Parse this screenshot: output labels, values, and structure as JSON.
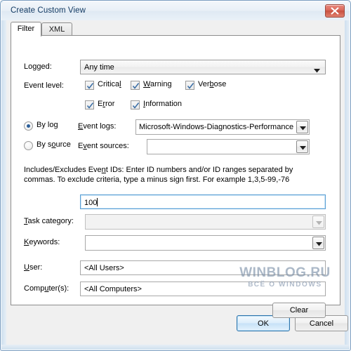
{
  "window": {
    "title": "Create Custom View",
    "close_icon": "close-icon"
  },
  "tabs": [
    {
      "label": "Filter",
      "active": true
    },
    {
      "label": "XML",
      "active": false
    }
  ],
  "filter": {
    "logged": {
      "label": "Logged:",
      "label_pre": "Lo",
      "label_accel": "g",
      "label_post": "ged:",
      "value": "Any time"
    },
    "event_level": {
      "label": "Event level:",
      "checkboxes": [
        {
          "name": "critical",
          "pre": "Critica",
          "accel": "l",
          "post": "",
          "checked": true
        },
        {
          "name": "warning",
          "pre": "",
          "accel": "W",
          "post": "arning",
          "checked": true
        },
        {
          "name": "verbose",
          "pre": "Ver",
          "accel": "b",
          "post": "ose",
          "checked": true
        },
        {
          "name": "error",
          "pre": "E",
          "accel": "r",
          "post": "ror",
          "checked": true
        },
        {
          "name": "information",
          "pre": "",
          "accel": "I",
          "post": "nformation",
          "checked": true
        }
      ]
    },
    "by_log_radio": {
      "pre": "By lo",
      "accel": "g",
      "post": "",
      "selected": true
    },
    "by_source_radio": {
      "pre": "By s",
      "accel": "o",
      "post": "urce",
      "selected": false
    },
    "event_logs": {
      "label_pre": "",
      "label_accel": "E",
      "label_post": "vent logs:",
      "value": "Microsoft-Windows-Diagnostics-Performance",
      "enabled": true
    },
    "event_sources": {
      "label_pre": "E",
      "label_accel": "v",
      "label_post": "ent sources:",
      "value": "",
      "enabled": true
    },
    "event_ids_hint_line1": "Includes/Excludes Eve̲nt IDs: Enter ID numbers and/or ID ranges separated by commas. To",
    "event_ids_hint_line2": "exclude criteria, type a minus sign first. For example 1,3,5-99,-76",
    "event_ids_hint_pre": "Includes/Excludes Eve",
    "event_ids_hint_accel": "n",
    "event_ids_hint_post": "t IDs: Enter ID numbers and/or ID ranges separated by commas. To exclude criteria, type a minus sign first. For example 1,3,5-99,-76",
    "event_ids_input": {
      "value": "100",
      "focused": true
    },
    "task_category": {
      "label_pre": "",
      "label_accel": "T",
      "label_post": "ask category:",
      "value": "",
      "enabled": false
    },
    "keywords": {
      "label_pre": "",
      "label_accel": "K",
      "label_post": "eywords:",
      "value": "",
      "enabled": true
    },
    "user": {
      "label_pre": "",
      "label_accel": "U",
      "label_post": "ser:",
      "value": "<All Users>"
    },
    "computers": {
      "label_pre": "Comp",
      "label_accel": "u",
      "label_post": "ter(s):",
      "value": "<All Computers>"
    },
    "clear_button": "Clear"
  },
  "footer": {
    "ok_label": "OK",
    "cancel_label": "Cancel"
  },
  "watermark": {
    "main": "WINBLOG.RU",
    "sub": "ВСЁ О WINDOWS"
  },
  "colors": {
    "title_text": "#123a63",
    "close_red": "#d9685a",
    "default_button_border": "#2c73ab",
    "focus_border": "#5a9fd4",
    "radio_dot": "#2b5f99"
  }
}
